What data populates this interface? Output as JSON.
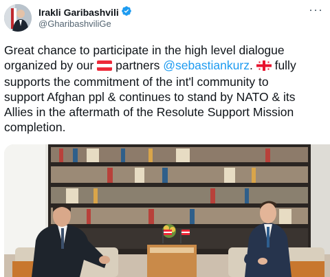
{
  "author": {
    "name": "Irakli Garibashvili",
    "handle": "@GharibashviliGe",
    "verified_icon": "verified-badge-icon",
    "badge_color": "#1d9bf0"
  },
  "tweet": {
    "lines": {
      "l1": "Great chance to participate in the high level dialogue",
      "l2_a": "organized by our",
      "l2_b": "partners",
      "l2_mention": "@sebastiankurz",
      "l2_c": ".",
      "l2_d": "fully",
      "l3": "supports the commitment of the int'l community to",
      "l4": "support Afghan ppl & continues to stand by NATO & its",
      "l5": "Allies in the aftermath of the Resolute Support Mission",
      "l6": "completion."
    },
    "emoji": [
      "austria-flag-icon",
      "georgia-flag-icon"
    ],
    "mention_color": "#1d9bf0"
  },
  "more_icon": "more-options-icon"
}
